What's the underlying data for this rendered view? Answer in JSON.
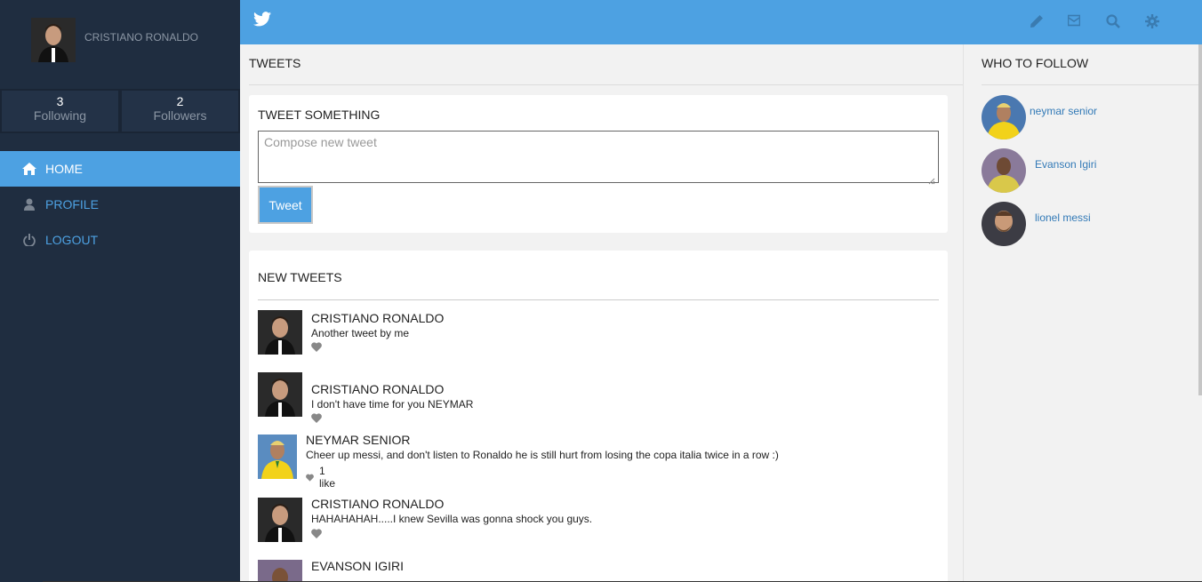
{
  "sidebar": {
    "user_name": "CRISTIANO RONALDO",
    "stats": [
      {
        "count": "3",
        "label": "Following"
      },
      {
        "count": "2",
        "label": "Followers"
      }
    ],
    "nav": [
      {
        "label": "HOME",
        "icon": "home-icon",
        "active": true
      },
      {
        "label": "PROFILE",
        "icon": "user-icon",
        "active": false
      },
      {
        "label": "LOGOUT",
        "icon": "power-icon",
        "active": false
      }
    ]
  },
  "topbar": {
    "logo_icon": "twitter-bird-icon",
    "tools": [
      "pencil-icon",
      "mail-icon",
      "search-icon",
      "gear-icon"
    ]
  },
  "main": {
    "heading": "TWEETS",
    "compose": {
      "title": "TWEET SOMETHING",
      "placeholder": "Compose new tweet",
      "button": "Tweet"
    },
    "feed": {
      "title": "NEW TWEETS",
      "tweets": [
        {
          "author": "CRISTIANO RONALDO",
          "text": "Another tweet by me",
          "likes": ""
        },
        {
          "author": "CRISTIANO RONALDO",
          "text": "I don't have time for you NEYMAR",
          "likes": ""
        },
        {
          "author": "NEYMAR SENIOR",
          "text": "Cheer up messi, and don't listen to Ronaldo he is still hurt from losing the copa italia twice in a row :)",
          "likes": "1 like"
        },
        {
          "author": "CRISTIANO RONALDO",
          "text": "HAHAHAHAH.....I knew Sevilla was gonna shock you guys.",
          "likes": ""
        },
        {
          "author": "EVANSON IGIRI",
          "text": "",
          "likes": ""
        }
      ]
    }
  },
  "right": {
    "heading": "WHO TO FOLLOW",
    "suggestions": [
      {
        "name": "neymar senior"
      },
      {
        "name": "Evanson Igiri"
      },
      {
        "name": "lionel messi"
      }
    ]
  },
  "colors": {
    "accent": "#4da1e2",
    "sidebar_bg": "#1f2d40",
    "link": "#337ab7"
  }
}
